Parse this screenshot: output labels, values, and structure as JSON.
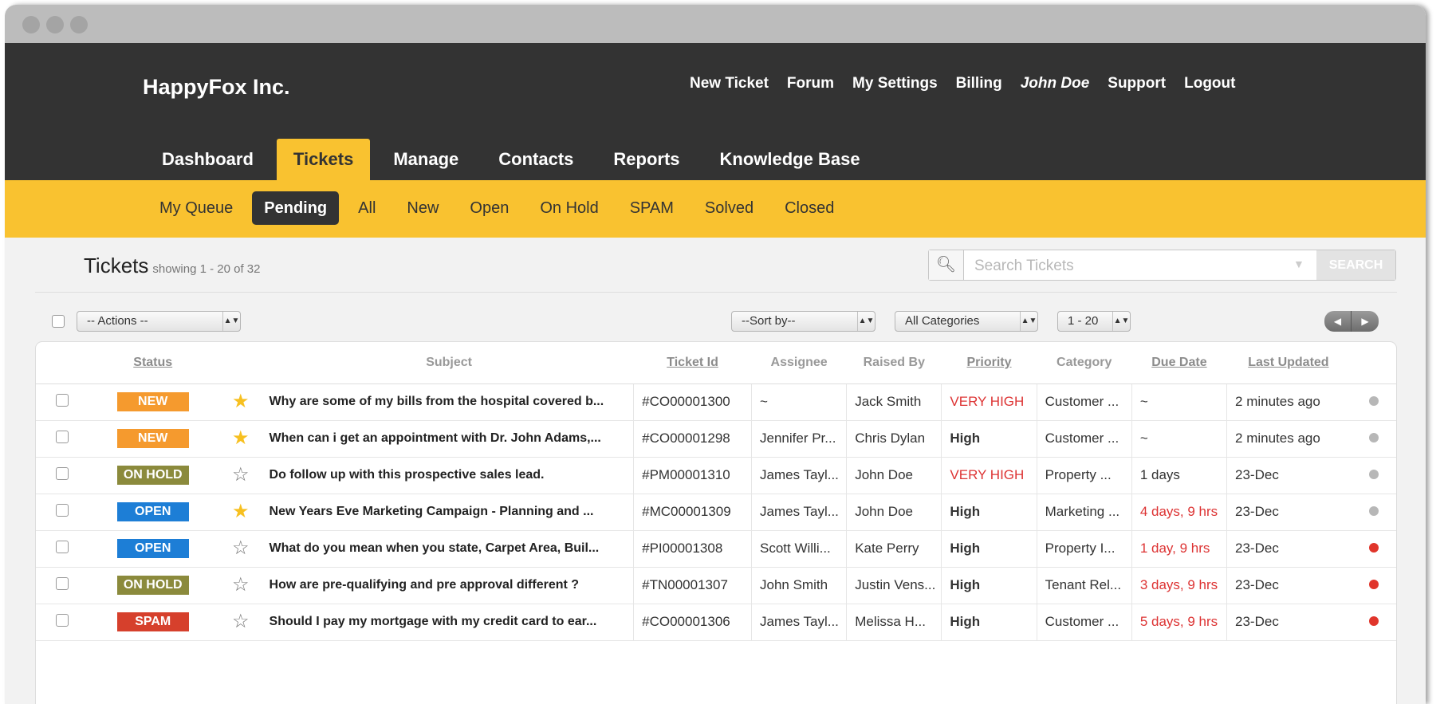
{
  "app": {
    "name": "HappyFox Inc."
  },
  "top_links": [
    "New Ticket",
    "Forum",
    "My Settings",
    "Billing",
    "John Doe",
    "Support",
    "Logout"
  ],
  "main_nav": [
    {
      "label": "Dashboard",
      "active": false
    },
    {
      "label": "Tickets",
      "active": true
    },
    {
      "label": "Manage",
      "active": false
    },
    {
      "label": "Contacts",
      "active": false
    },
    {
      "label": "Reports",
      "active": false
    },
    {
      "label": "Knowledge Base",
      "active": false
    }
  ],
  "sub_nav": [
    {
      "label": "My Queue",
      "active": false
    },
    {
      "label": "Pending",
      "active": true
    },
    {
      "label": "All",
      "active": false
    },
    {
      "label": "New",
      "active": false
    },
    {
      "label": "Open",
      "active": false
    },
    {
      "label": "On Hold",
      "active": false
    },
    {
      "label": "SPAM",
      "active": false
    },
    {
      "label": "Solved",
      "active": false
    },
    {
      "label": "Closed",
      "active": false
    }
  ],
  "page": {
    "title": "Tickets",
    "showing": "showing 1 - 20 of 32"
  },
  "search": {
    "placeholder": "Search Tickets",
    "button": "SEARCH"
  },
  "toolbar": {
    "actions": "-- Actions --",
    "sort": "--Sort by--",
    "category": "All Categories",
    "range": "1 - 20"
  },
  "columns": {
    "status": "Status",
    "subject": "Subject",
    "ticket_id": "Ticket Id",
    "assignee": "Assignee",
    "raised_by": "Raised By",
    "priority": "Priority",
    "category": "Category",
    "due_date": "Due Date",
    "last_updated": "Last Updated"
  },
  "colors": {
    "NEW": "#f59a2e",
    "ON HOLD": "#8b8a3c",
    "OPEN": "#1d7ed6",
    "SPAM": "#d6402c",
    "dot_grey": "#b7b7b7",
    "dot_red": "#e0352b",
    "star_on": "#f7c020",
    "star_off": "#777777"
  },
  "tickets": [
    {
      "status": "NEW",
      "starred": true,
      "subject": "Why are some of my bills from the hospital covered b...",
      "id": "#CO00001300",
      "assignee": "~",
      "raised_by": "Jack Smith",
      "priority": "VERY HIGH",
      "category": "Customer ...",
      "due": "~",
      "due_overdue": false,
      "updated": "2 minutes ago",
      "dot": "grey"
    },
    {
      "status": "NEW",
      "starred": true,
      "subject": "When can i get an appointment with Dr. John Adams,...",
      "id": "#CO00001298",
      "assignee": "Jennifer Pr...",
      "raised_by": "Chris Dylan",
      "priority": "High",
      "category": "Customer ...",
      "due": "~",
      "due_overdue": false,
      "updated": "2 minutes ago",
      "dot": "grey"
    },
    {
      "status": "ON HOLD",
      "starred": false,
      "subject": "Do follow up with this prospective sales lead.",
      "id": "#PM00001310",
      "assignee": "James Tayl...",
      "raised_by": "John Doe",
      "priority": "VERY HIGH",
      "category": "Property ...",
      "due": "1 days",
      "due_overdue": false,
      "updated": "23-Dec",
      "dot": "grey"
    },
    {
      "status": "OPEN",
      "starred": true,
      "subject": "New Years Eve Marketing Campaign - Planning and ...",
      "id": "#MC00001309",
      "assignee": "James Tayl...",
      "raised_by": "John Doe",
      "priority": "High",
      "category": "Marketing ...",
      "due": "4 days, 9 hrs",
      "due_overdue": true,
      "updated": "23-Dec",
      "dot": "grey"
    },
    {
      "status": "OPEN",
      "starred": false,
      "subject": "What do you mean when you state, Carpet Area, Buil...",
      "id": "#PI00001308",
      "assignee": "Scott Willi...",
      "raised_by": "Kate Perry",
      "priority": "High",
      "category": "Property I...",
      "due": "1 day, 9 hrs",
      "due_overdue": true,
      "updated": "23-Dec",
      "dot": "red"
    },
    {
      "status": "ON HOLD",
      "starred": false,
      "subject": "How are pre-qualifying and pre approval different ?",
      "id": "#TN00001307",
      "assignee": "John Smith",
      "raised_by": "Justin Vens...",
      "priority": "High",
      "category": "Tenant Rel...",
      "due": "3 days, 9 hrs",
      "due_overdue": true,
      "updated": "23-Dec",
      "dot": "red"
    },
    {
      "status": "SPAM",
      "starred": false,
      "subject": "Should I pay my mortgage with my credit card to ear...",
      "id": "#CO00001306",
      "assignee": "James Tayl...",
      "raised_by": "Melissa H...",
      "priority": "High",
      "category": "Customer ...",
      "due": "5 days, 9 hrs",
      "due_overdue": true,
      "updated": "23-Dec",
      "dot": "red"
    }
  ]
}
